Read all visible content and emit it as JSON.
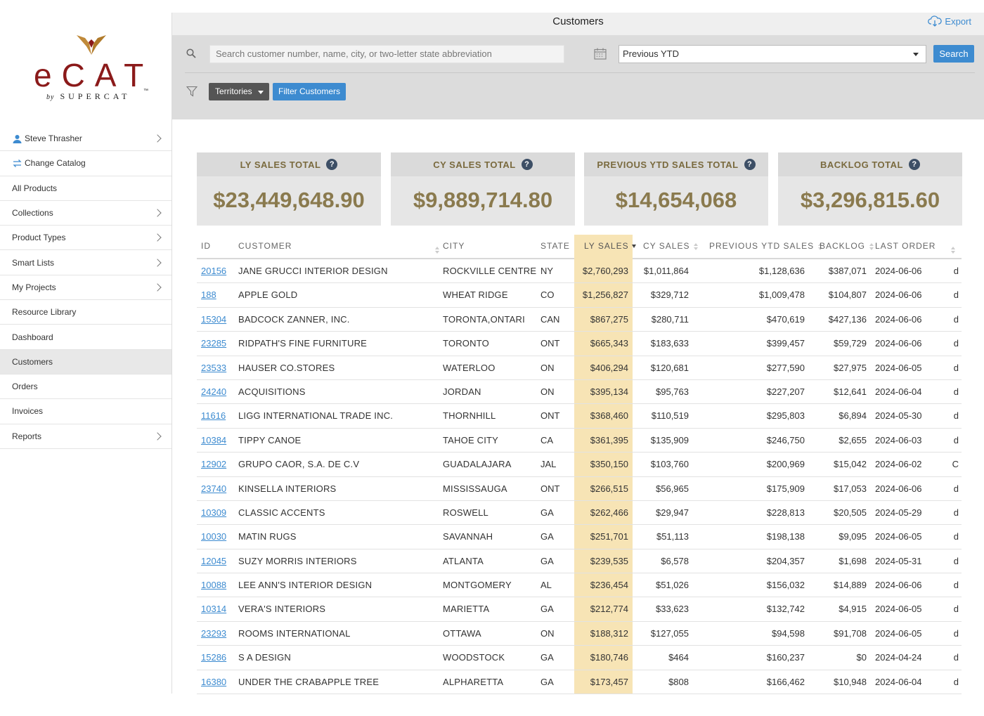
{
  "app": {
    "title": "Customers",
    "export_label": "Export"
  },
  "logo": {
    "word": "eCAT",
    "by": "by",
    "sub": "SUPERCAT",
    "tm": "™"
  },
  "sidebar": {
    "items": [
      {
        "label": "Steve Thrasher",
        "icon": "user-icon",
        "chevron": true
      },
      {
        "label": "Change Catalog",
        "icon": "swap-icon",
        "chevron": false
      },
      {
        "label": "All Products",
        "chevron": false
      },
      {
        "label": "Collections",
        "chevron": true
      },
      {
        "label": "Product Types",
        "chevron": true
      },
      {
        "label": "Smart Lists",
        "chevron": true
      },
      {
        "label": "My Projects",
        "chevron": true
      },
      {
        "label": "Resource Library",
        "chevron": false
      },
      {
        "label": "Dashboard",
        "chevron": false
      },
      {
        "label": "Customers",
        "chevron": false,
        "active": true
      },
      {
        "label": "Orders",
        "chevron": false
      },
      {
        "label": "Invoices",
        "chevron": false
      },
      {
        "label": "Reports",
        "chevron": true
      }
    ]
  },
  "search": {
    "placeholder": "Search customer number, name, city, or two-letter state abbreviation",
    "button": "Search"
  },
  "period": {
    "selected": "Previous YTD"
  },
  "filters": {
    "territories": "Territories",
    "filter_button": "Filter Customers"
  },
  "cards": [
    {
      "label": "LY SALES TOTAL",
      "value": "$23,449,648.90"
    },
    {
      "label": "CY SALES TOTAL",
      "value": "$9,889,714.80"
    },
    {
      "label": "PREVIOUS YTD SALES TOTAL",
      "value": "$14,654,068"
    },
    {
      "label": "BACKLOG TOTAL",
      "value": "$3,296,815.60"
    }
  ],
  "help_glyph": "?",
  "table": {
    "headers": [
      "ID",
      "CUSTOMER",
      "CITY",
      "STATE",
      "LY SALES",
      "CY SALES",
      "PREVIOUS YTD SALES",
      "BACKLOG",
      "LAST ORDER"
    ],
    "rows": [
      [
        "20156",
        "JANE GRUCCI INTERIOR DESIGN",
        "ROCKVILLE CENTRE",
        "NY",
        "$2,760,293",
        "$1,011,864",
        "$1,128,636",
        "$387,071",
        "2024-06-06",
        "d"
      ],
      [
        "188",
        "APPLE GOLD",
        "WHEAT RIDGE",
        "CO",
        "$1,256,827",
        "$329,712",
        "$1,009,478",
        "$104,807",
        "2024-06-06",
        "d"
      ],
      [
        "15304",
        "BADCOCK ZANNER, INC.",
        "TORONTA,ONTARI",
        "CAN",
        "$867,275",
        "$280,711",
        "$470,619",
        "$427,136",
        "2024-06-06",
        "d"
      ],
      [
        "23285",
        "RIDPATH'S FINE FURNITURE",
        "TORONTO",
        "ONT",
        "$665,343",
        "$183,633",
        "$399,457",
        "$59,729",
        "2024-06-06",
        "d"
      ],
      [
        "23533",
        "HAUSER CO.STORES",
        "WATERLOO",
        "ON",
        "$406,294",
        "$120,681",
        "$277,590",
        "$27,975",
        "2024-06-05",
        "d"
      ],
      [
        "24240",
        "ACQUISITIONS",
        "JORDAN",
        "ON",
        "$395,134",
        "$95,763",
        "$227,207",
        "$12,641",
        "2024-06-04",
        "d"
      ],
      [
        "11616",
        "LIGG INTERNATIONAL TRADE INC.",
        "THORNHILL",
        "ONT",
        "$368,460",
        "$110,519",
        "$295,803",
        "$6,894",
        "2024-05-30",
        "d"
      ],
      [
        "10384",
        "TIPPY CANOE",
        "TAHOE CITY",
        "CA",
        "$361,395",
        "$135,909",
        "$246,750",
        "$2,655",
        "2024-06-03",
        "d"
      ],
      [
        "12902",
        "GRUPO CAOR, S.A. DE C.V",
        "GUADALAJARA",
        "JAL",
        "$350,150",
        "$103,760",
        "$200,969",
        "$15,042",
        "2024-06-02",
        "C"
      ],
      [
        "23740",
        "KINSELLA INTERIORS",
        "MISSISSAUGA",
        "ONT",
        "$266,515",
        "$56,965",
        "$175,909",
        "$17,053",
        "2024-06-06",
        "d"
      ],
      [
        "10309",
        "CLASSIC ACCENTS",
        "ROSWELL",
        "GA",
        "$262,466",
        "$29,947",
        "$228,813",
        "$20,505",
        "2024-05-29",
        "d"
      ],
      [
        "10030",
        "MATIN RUGS",
        "SAVANNAH",
        "GA",
        "$251,701",
        "$51,113",
        "$198,138",
        "$9,095",
        "2024-06-05",
        "d"
      ],
      [
        "12045",
        "SUZY MORRIS INTERIORS",
        "ATLANTA",
        "GA",
        "$239,535",
        "$6,578",
        "$204,357",
        "$1,698",
        "2024-05-31",
        "d"
      ],
      [
        "10088",
        "LEE ANN'S INTERIOR DESIGN",
        "MONTGOMERY",
        "AL",
        "$236,454",
        "$51,026",
        "$156,032",
        "$14,889",
        "2024-06-06",
        "d"
      ],
      [
        "10314",
        "VERA'S INTERIORS",
        "MARIETTA",
        "GA",
        "$212,774",
        "$33,623",
        "$132,742",
        "$4,915",
        "2024-06-05",
        "d"
      ],
      [
        "23293",
        "ROOMS INTERNATIONAL",
        "OTTAWA",
        "ON",
        "$188,312",
        "$127,055",
        "$94,598",
        "$91,708",
        "2024-06-05",
        "d"
      ],
      [
        "15286",
        "S A DESIGN",
        "WOODSTOCK",
        "GA",
        "$180,746",
        "$464",
        "$160,237",
        "$0",
        "2024-04-24",
        "d"
      ],
      [
        "16380",
        "UNDER THE CRABAPPLE TREE",
        "ALPHARETTA",
        "GA",
        "$173,457",
        "$808",
        "$166,462",
        "$10,948",
        "2024-06-04",
        "d"
      ]
    ]
  },
  "colors": {
    "accent": "#3d8bd0",
    "brand": "#8b1a1a",
    "sorted_column": "#f7e4b5",
    "card_text": "#8a7a4e"
  }
}
